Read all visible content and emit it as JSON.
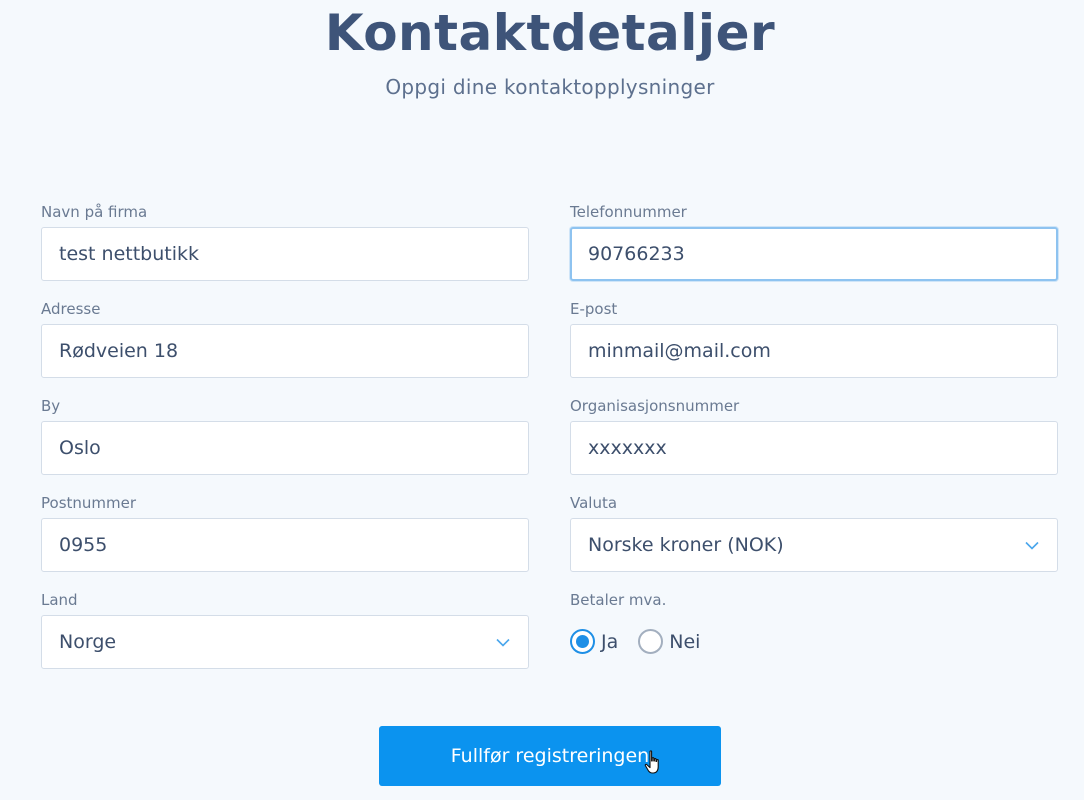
{
  "header": {
    "title": "Kontaktdetaljer",
    "subtitle": "Oppgi dine kontaktopplysninger"
  },
  "form": {
    "company_name": {
      "label": "Navn på firma",
      "value": "test nettbutikk"
    },
    "phone": {
      "label": "Telefonnummer",
      "value": "90766233"
    },
    "address": {
      "label": "Adresse",
      "value": "Rødveien 18"
    },
    "email": {
      "label": "E-post",
      "value": "minmail@mail.com"
    },
    "city": {
      "label": "By",
      "value": "Oslo"
    },
    "org_number": {
      "label": "Organisasjonsnummer",
      "value": "xxxxxxx"
    },
    "postcode": {
      "label": "Postnummer",
      "value": "0955"
    },
    "currency": {
      "label": "Valuta",
      "selected": "Norske kroner (NOK)"
    },
    "country": {
      "label": "Land",
      "selected": "Norge"
    },
    "vat": {
      "label": "Betaler mva.",
      "options": [
        {
          "label": "Ja",
          "checked": true
        },
        {
          "label": "Nei",
          "checked": false
        }
      ]
    }
  },
  "submit": {
    "label": "Fullfør registreringen"
  },
  "colors": {
    "accent": "#0b93ef",
    "title": "#3e5479",
    "background": "#f5f9fd",
    "radio_checked": "#1e8fe6"
  },
  "icons": {
    "select_arrow": "chevron-down-icon",
    "cursor": "hand-pointer-icon"
  }
}
